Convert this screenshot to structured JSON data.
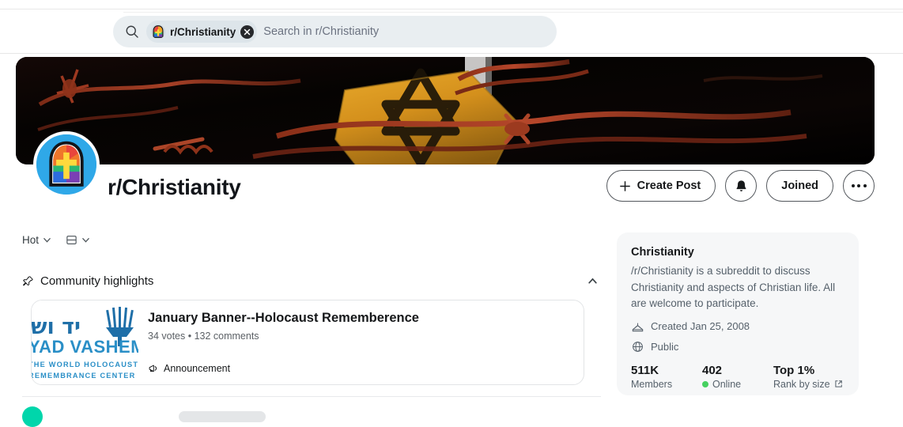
{
  "search": {
    "chip_label": "r/Christianity",
    "placeholder": "Search in r/Christianity"
  },
  "community": {
    "title": "r/Christianity",
    "banner_alt": "Yellow Star of David badge with barbed wire"
  },
  "actions": {
    "create_post": "Create Post",
    "joined": "Joined"
  },
  "feed": {
    "sort": "Hot",
    "highlights_title": "Community highlights",
    "highlight": {
      "title": "January Banner--Holocaust Rememberence",
      "meta": "34 votes • 132 comments",
      "tag": "Announcement",
      "thumb_hebrew": "יד ושם",
      "thumb_name": "YAD VASHEM",
      "thumb_sub1": "THE WORLD HOLOCAUST",
      "thumb_sub2": "REMEMBRANCE CENTER"
    }
  },
  "sidebar": {
    "title": "Christianity",
    "description": "/r/Christianity is a subreddit to discuss Christianity and aspects of Christian life. All are welcome to participate.",
    "created": "Created Jan 25, 2008",
    "visibility": "Public",
    "stats": [
      {
        "value": "511K",
        "label": "Members"
      },
      {
        "value": "402",
        "label": "Online"
      },
      {
        "value": "Top 1%",
        "label": "Rank by size"
      }
    ]
  },
  "colors": {
    "accent": "#2fa8e8",
    "online": "#46d160",
    "panel": "#f6f7f8",
    "search_bg": "#e9eef1"
  }
}
